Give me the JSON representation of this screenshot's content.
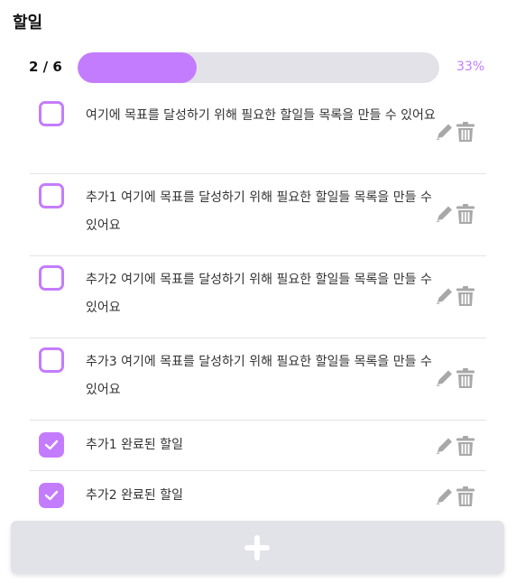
{
  "header": {
    "title": "할일"
  },
  "progress": {
    "count_text": "2 / 6",
    "fraction": 0.33,
    "percent_text": "33%",
    "colors": {
      "fill": "#c47cff",
      "track": "#e2e2e8"
    }
  },
  "todos": [
    {
      "text": "여기에 목표를 달성하기 위해 필요한 할일들 목록을 만들 수 있어요",
      "done": false
    },
    {
      "text": "추가1 여기에 목표를 달성하기 위해 필요한 할일들 목록을 만들 수 있어요",
      "done": false
    },
    {
      "text": "추가2 여기에 목표를 달성하기 위해 필요한 할일들 목록을 만들 수 있어요",
      "done": false
    },
    {
      "text": "추가3 여기에 목표를 달성하기 위해 필요한 할일들 목록을 만들 수 있어요",
      "done": false
    },
    {
      "text": "추가1 완료된 할일",
      "done": true
    },
    {
      "text": "추가2 완료된 할일",
      "done": true
    }
  ],
  "icons": {
    "edit": "pencil-icon",
    "delete": "trash-icon",
    "add": "plus-icon",
    "checked": "checkmark-icon"
  },
  "colors": {
    "accent": "#c47cff",
    "icon_gray": "#a8a8a8",
    "add_button_bg": "#e2e3e8"
  }
}
